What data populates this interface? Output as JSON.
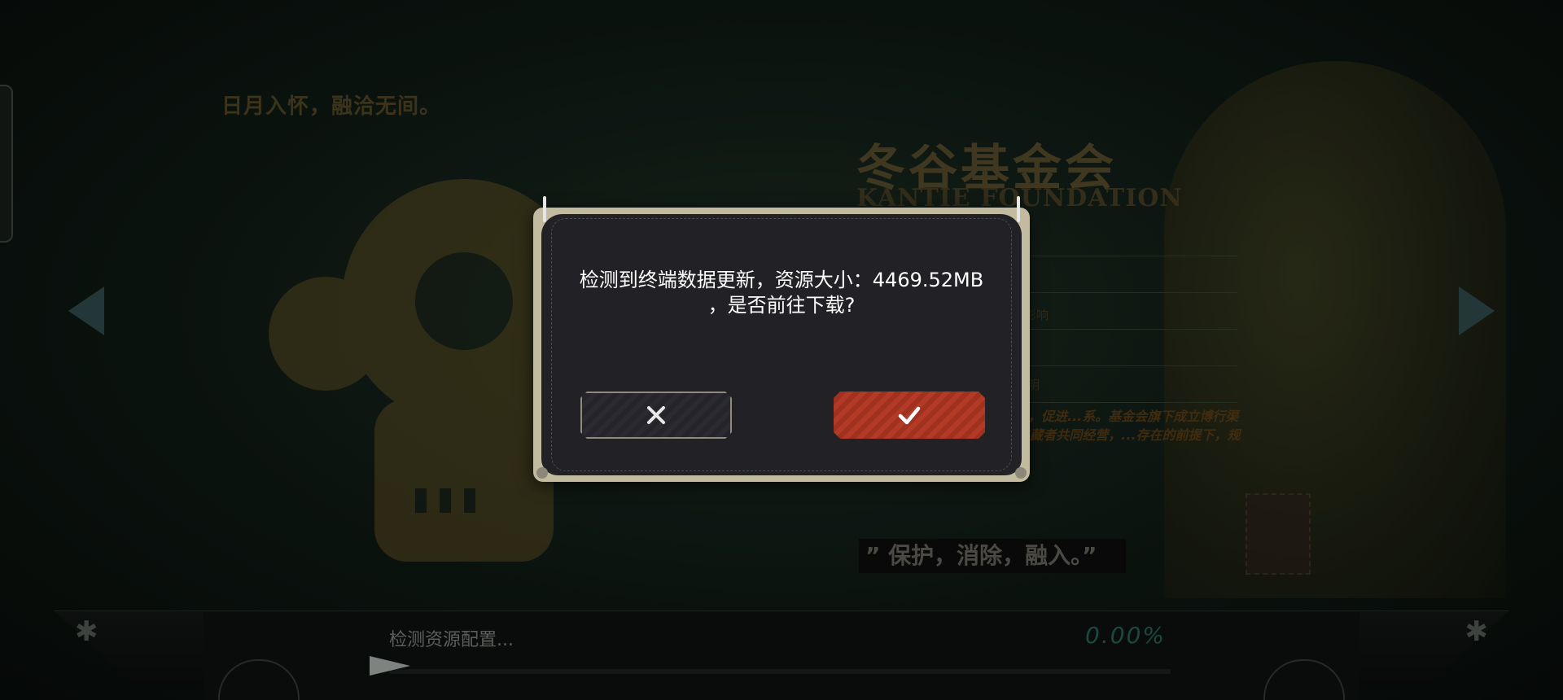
{
  "background": {
    "slogan": "日月入怀，融洽无间。",
    "foundation_title": "冬谷基金会",
    "foundation_subtitle": "KANTIE FOUNDATION",
    "faint_text_1": "戏的影响",
    "faint_text_2": "明",
    "paragraph": "熟悉社会生活，了解现代文化，促进...系。基金会旗下成立博行渠道公司、...机构，由收藏家与藏者共同经营，...存在的前提下，规范收藏家与藏者的社会活动。",
    "motto": "” 保护，消除，融入。”"
  },
  "dialog": {
    "message_line1": "检测到终端数据更新，资源大小：4469.52MB",
    "message_line2": "，是否前往下载?",
    "cancel_icon": "close-icon",
    "confirm_icon": "check-icon"
  },
  "bottom_bar": {
    "status_text": "检测资源配置...",
    "progress_text": "0.00%",
    "progress_value": 0.0
  },
  "colors": {
    "dialog_frame": "#c3bba0",
    "dialog_body": "#222125",
    "confirm_button": "#b23a26",
    "progress_accent": "#1f5a4e"
  }
}
